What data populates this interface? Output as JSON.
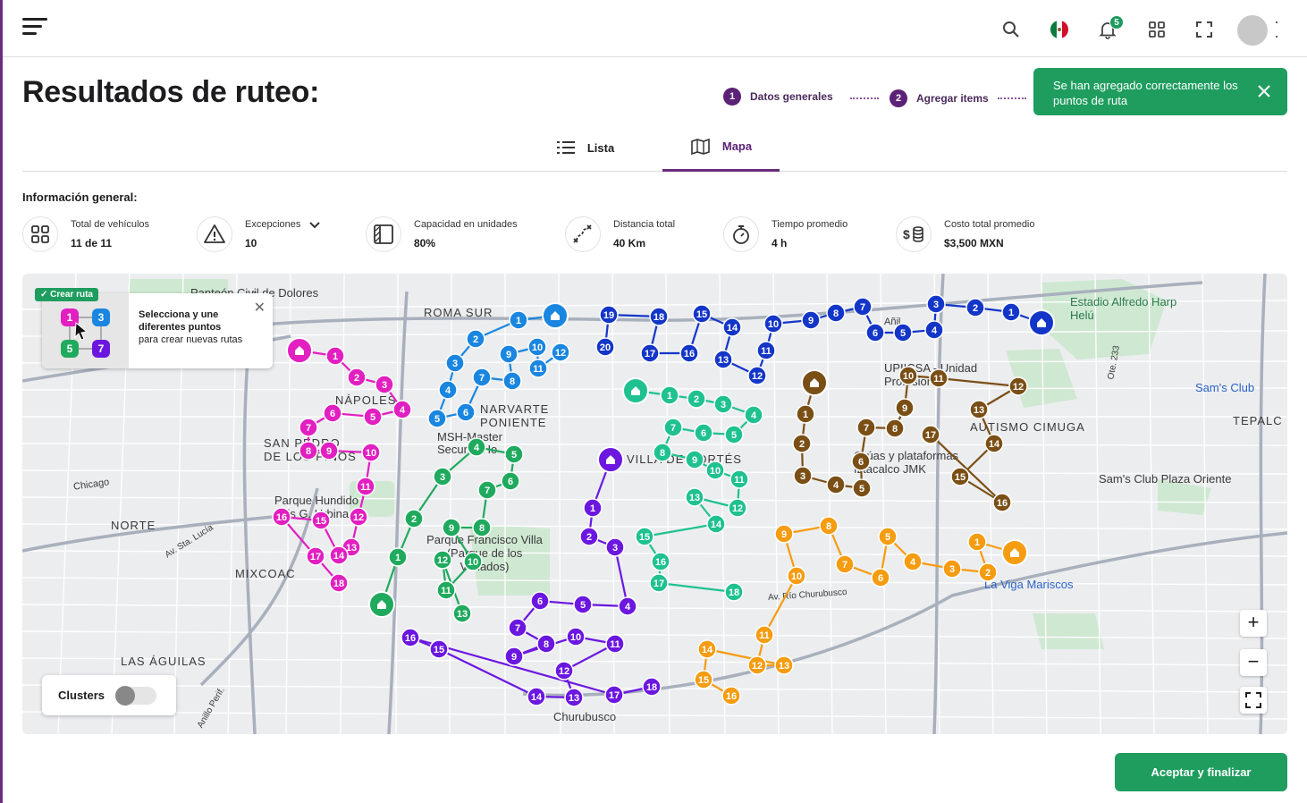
{
  "header": {
    "notification_count": "5",
    "icons": [
      "menu-icon",
      "search-icon",
      "mexico-flag-icon",
      "bell-icon",
      "apps-grid-icon",
      "fullscreen-icon",
      "avatar"
    ]
  },
  "page": {
    "title": "Resultados de ruteo:"
  },
  "stepper": {
    "steps": [
      {
        "num": "1",
        "label": "Datos generales"
      },
      {
        "num": "2",
        "label": "Agregar items"
      }
    ]
  },
  "toast": {
    "message": "Se han agregado correctamente los puntos de ruta"
  },
  "tabs": [
    {
      "label": "Lista",
      "active": false
    },
    {
      "label": "Mapa",
      "active": true
    }
  ],
  "info": {
    "title": "Información general:",
    "kpis": [
      {
        "label": "Total de vehículos",
        "value": "11 de 11",
        "icon": "grid-icon"
      },
      {
        "label": "Excepciones",
        "value": "10",
        "icon": "warning-icon"
      },
      {
        "label": "Capacidad en unidades",
        "value": "80%",
        "icon": "capacity-icon"
      },
      {
        "label": "Distancia total",
        "value": "40 Km",
        "icon": "route-distance-icon"
      },
      {
        "label": "Tiempo promedio",
        "value": "4 h",
        "icon": "stopwatch-icon"
      },
      {
        "label": "Costo total promedio",
        "value": "$3,500 MXN",
        "icon": "money-stack-icon"
      }
    ]
  },
  "map": {
    "labels": [
      "Panteón Civil de Dolores",
      "ROMA SUR",
      "NÁPOLES",
      "NARVARTE PONIENTE",
      "MSH-Master Security Ho",
      "SAN PEDRO DE LOS PINOS",
      "Parque Hundido Luis G. Urbina",
      "NORTE",
      "Chicago",
      "MIXCOAC",
      "Av. Sta. Lucía",
      "LAS ÁGUILAS",
      "VILLA DE CORTÉS",
      "Parque Francisco Villa (Parque de los Venados)",
      "Churubusco",
      "Estadio Alfredo Harp Helú",
      "UPIICSA - Unidad Profesional",
      "AUTISMO CIMUGA",
      "Sam's Club",
      "TEPALC",
      "Sam's Club Plaza Oriente",
      "Grúas y plataformas Iztacalco JMK",
      "La Viga Mariscos",
      "Av. Río Churubusco",
      "Anillo Perif.",
      "Añil",
      "Ote. 233"
    ],
    "popup": {
      "badge": "✓ Crear ruta",
      "title": "Selecciona y une diferentes puntos",
      "body": "para crear nuevas rutas",
      "sample_numbers": [
        "1",
        "3",
        "5",
        "7"
      ]
    },
    "clusters_label": "Clusters",
    "clusters_on": false,
    "zoom_in": "+",
    "zoom_out": "−",
    "route_colors": {
      "magenta": "#e21fc1",
      "blue": "#1a86e0",
      "navy": "#1436c8",
      "green": "#1faa5e",
      "teal": "#1fc190",
      "purple": "#6b17e0",
      "brown": "#7a4f16",
      "orange": "#f59c10"
    }
  },
  "footer": {
    "accept_label": "Aceptar y finalizar"
  }
}
